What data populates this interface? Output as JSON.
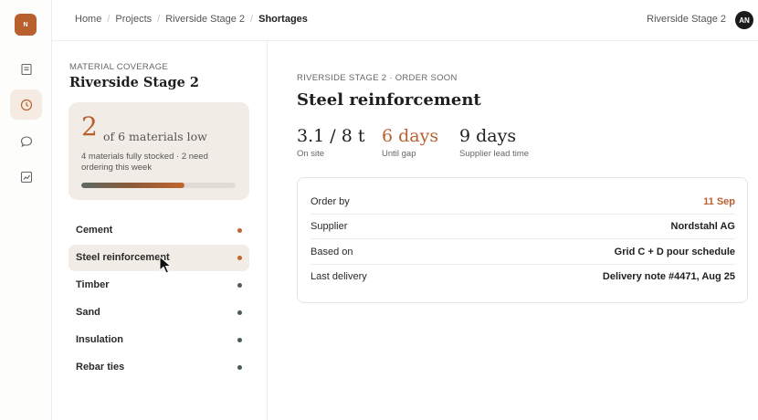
{
  "app": {
    "logo_text": "N",
    "accent_color": "#b8612f"
  },
  "rail": {
    "items": [
      {
        "icon": "document-icon"
      },
      {
        "icon": "clock-icon",
        "active": true
      },
      {
        "icon": "chat-icon"
      },
      {
        "icon": "chart-icon"
      }
    ]
  },
  "breadcrumb": {
    "items": [
      "Home",
      "Projects",
      "Riverside Stage 2",
      "Shortages"
    ]
  },
  "header": {
    "project": "Riverside Stage 2",
    "avatar_initials": "AN"
  },
  "coverage": {
    "eyebrow": "MATERIAL COVERAGE",
    "title": "Riverside Stage 2",
    "low_count": "2",
    "low_text": "of 6 materials low",
    "description": "4 materials fully stocked · 2 need ordering this week",
    "progress_fraction": 0.67
  },
  "materials": [
    {
      "label": "Cement",
      "status": "low"
    },
    {
      "label": "Steel reinforcement",
      "status": "low",
      "selected": true
    },
    {
      "label": "Timber",
      "status": "ok"
    },
    {
      "label": "Sand",
      "status": "ok"
    },
    {
      "label": "Insulation",
      "status": "ok"
    },
    {
      "label": "Rebar ties",
      "status": "ok"
    }
  ],
  "detail": {
    "eyebrow": "RIVERSIDE STAGE 2 · ORDER SOON",
    "title": "Steel reinforcement",
    "stats": [
      {
        "value": "3.1 / 8 t",
        "label": "On site"
      },
      {
        "value": "6 days",
        "label": "Until gap"
      },
      {
        "value": "9 days",
        "label": "Supplier lead time"
      }
    ],
    "rows": [
      {
        "label": "Order by",
        "value": "11 Sep"
      },
      {
        "label": "Supplier",
        "value": "Nordstahl AG"
      },
      {
        "label": "Based on",
        "value": "Grid C + D pour schedule"
      },
      {
        "label": "Last delivery",
        "value": "Delivery note #4471, Aug 25"
      }
    ]
  }
}
